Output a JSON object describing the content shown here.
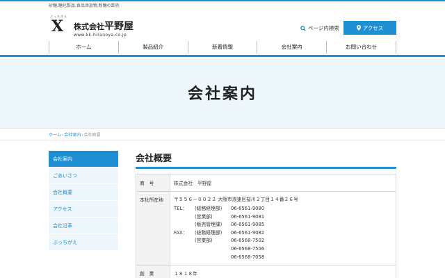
{
  "topbar": {
    "tagline": "砂糖,糖化製品,食品添加物,粉糖の卸売"
  },
  "logo": {
    "ruby": "ぶっちがえ",
    "corp": "株式会社",
    "name": "平野屋",
    "url": "www.kk-hiranoya.co.jp"
  },
  "header": {
    "search_label": "ページ内検索",
    "access_label": "アクセス"
  },
  "nav": [
    "ホーム",
    "製品紹介",
    "新着情報",
    "会社案内",
    "お問い合わせ"
  ],
  "hero": {
    "title": "会社案内"
  },
  "breadcrumb": {
    "home": "ホーム",
    "section": "会社案内",
    "current": "会社概要"
  },
  "sidebar": {
    "items": [
      "会社案内",
      "ごあいさつ",
      "会社概要",
      "アクセス",
      "会社沿革",
      "ぶっちがえ"
    ],
    "active_index": 0
  },
  "main": {
    "heading": "会社概要",
    "rows": {
      "company": {
        "label": "商　号",
        "value": "株式会社　平野屋"
      },
      "address": {
        "label": "本社所在地",
        "value": "〒５５６－００２２ 大阪市浪速区桜川２丁目１４番２６号",
        "tel_label": "TEL：",
        "fax_label": "FAX：",
        "tel": [
          {
            "dept": "(総務経理部)",
            "number": "06-6561-9080"
          },
          {
            "dept": "(営業部)",
            "number": "06-6561-9081"
          },
          {
            "dept": "(販売管理課)",
            "number": "06-6561-9085"
          }
        ],
        "fax": [
          {
            "dept": "(総務経理部)",
            "number": "06-6561-9082"
          },
          {
            "dept": "(営業部)",
            "number": "06-6568-7502"
          },
          {
            "dept": "",
            "number": "06-6568-7506"
          },
          {
            "dept": "",
            "number": "06-6568-7058"
          }
        ]
      },
      "founded": {
        "label": "創　業",
        "value": "１８１８年"
      }
    }
  },
  "colors": {
    "accent": "#1e8fd3",
    "hero_bg": "#eef7fb"
  },
  "icons": {
    "search": "search-icon",
    "access": "map-pin-icon",
    "logo_mark": "crossed-x-logo"
  }
}
